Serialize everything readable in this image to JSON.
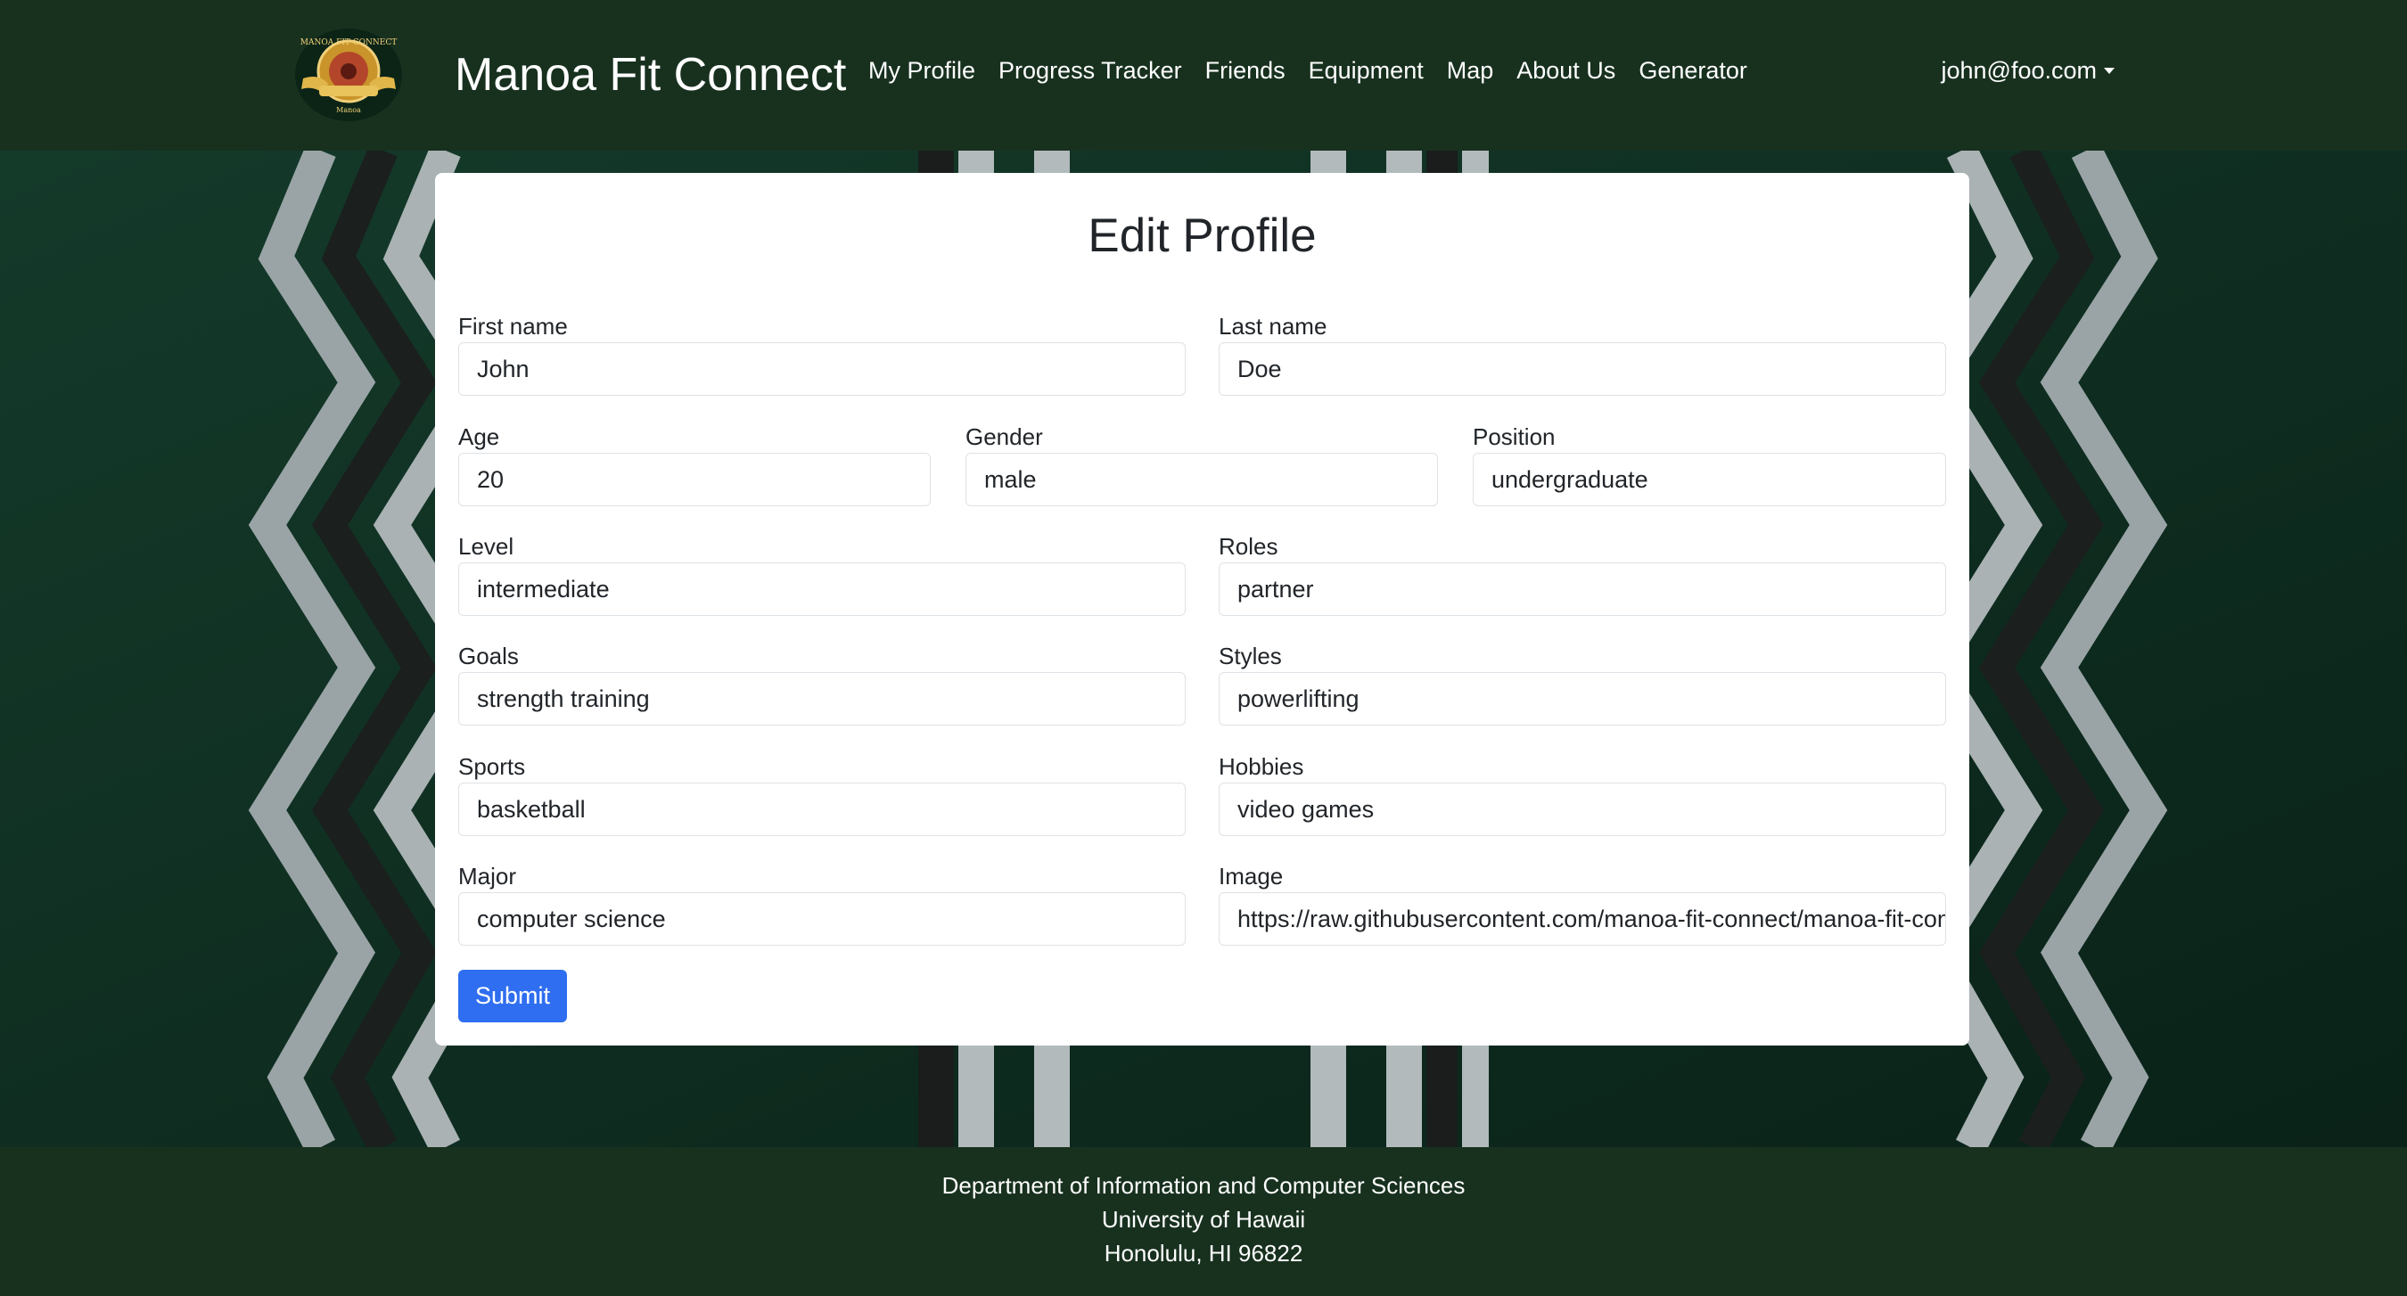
{
  "navbar": {
    "brand": "Manoa Fit Connect",
    "logo_icon": "manoa-fit-connect-logo",
    "links": [
      "My Profile",
      "Progress Tracker",
      "Friends",
      "Equipment",
      "Map",
      "About Us",
      "Generator"
    ],
    "user": "john@foo.com"
  },
  "form": {
    "title": "Edit Profile",
    "first_name": {
      "label": "First name",
      "value": "John"
    },
    "last_name": {
      "label": "Last name",
      "value": "Doe"
    },
    "age": {
      "label": "Age",
      "value": "20"
    },
    "gender": {
      "label": "Gender",
      "value": "male"
    },
    "position": {
      "label": "Position",
      "value": "undergraduate"
    },
    "level": {
      "label": "Level",
      "value": "intermediate"
    },
    "roles": {
      "label": "Roles",
      "value": "partner"
    },
    "goals": {
      "label": "Goals",
      "value": "strength training"
    },
    "styles": {
      "label": "Styles",
      "value": "powerlifting"
    },
    "sports": {
      "label": "Sports",
      "value": "basketball"
    },
    "hobbies": {
      "label": "Hobbies",
      "value": "video games"
    },
    "major": {
      "label": "Major",
      "value": "computer science"
    },
    "image": {
      "label": "Image",
      "value": "https://raw.githubusercontent.com/manoa-fit-connect/manoa-fit-connect"
    },
    "submit_label": "Submit"
  },
  "footer": {
    "line1": "Department of Information and Computer Sciences",
    "line2": "University of Hawaii",
    "line3": "Honolulu, HI 96822"
  },
  "colors": {
    "navbar": "#18311f",
    "accent": "#2f6ef0",
    "background": "#0f2a1e"
  }
}
